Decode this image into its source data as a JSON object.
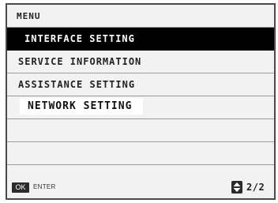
{
  "menu": {
    "title": "MENU",
    "items": [
      {
        "label": "INTERFACE SETTING",
        "state": "selected"
      },
      {
        "label": "SERVICE INFORMATION",
        "state": "normal"
      },
      {
        "label": "ASSISTANCE SETTING",
        "state": "normal"
      },
      {
        "label": "NETWORK SETTING",
        "state": "highlighted"
      }
    ]
  },
  "footer": {
    "ok_label": "OK",
    "enter_label": "ENTER",
    "scroll_icon": "up-down-scroll-icon",
    "page_indicator": "2/2"
  },
  "colors": {
    "background": "#f2f2f2",
    "selected_row": "#000000",
    "border": "#4a4a4a"
  }
}
